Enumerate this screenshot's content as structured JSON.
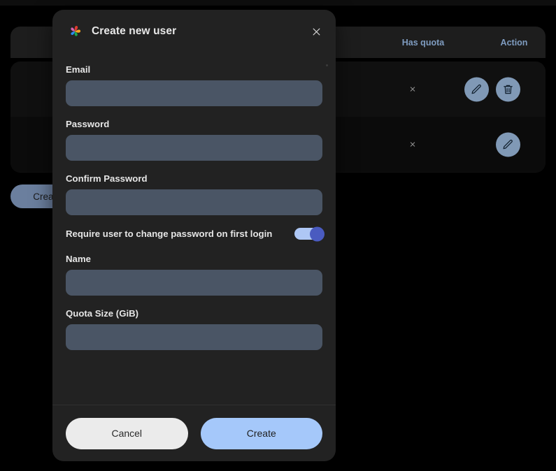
{
  "app": {
    "brand_logo_icon": "immich-pinwheel-logo",
    "page_background": "#000000"
  },
  "background_table": {
    "columns": [
      {
        "label": "Has quota"
      },
      {
        "label": "Action"
      }
    ],
    "rows": [
      {
        "has_quota": "×",
        "actions": [
          "edit-pencil-icon",
          "delete-trash-icon"
        ]
      },
      {
        "has_quota": "×",
        "actions": [
          "edit-pencil-icon"
        ]
      }
    ],
    "create_button_label": "Create"
  },
  "dialog": {
    "title": "Create new user",
    "close_icon": "close-x-icon",
    "fields": [
      {
        "label": "Email",
        "value": "",
        "placeholder": ""
      },
      {
        "label": "Password",
        "value": "",
        "placeholder": ""
      },
      {
        "label": "Confirm Password",
        "value": "",
        "placeholder": ""
      }
    ],
    "toggle": {
      "label": "Require user to change password on first login",
      "state": "on",
      "track_color": "#aec7f5",
      "knob_color": "#4a5bc0"
    },
    "fields_after_toggle": [
      {
        "label": "Name",
        "value": "",
        "placeholder": ""
      },
      {
        "label": "Quota Size (GiB)",
        "value": "",
        "placeholder": ""
      }
    ],
    "footer": {
      "cancel_label": "Cancel",
      "create_label": "Create",
      "cancel_color": "#ebebeb",
      "create_color": "#a5c8fa"
    },
    "input_background": "#4a5565",
    "surface_color": "#222222"
  }
}
